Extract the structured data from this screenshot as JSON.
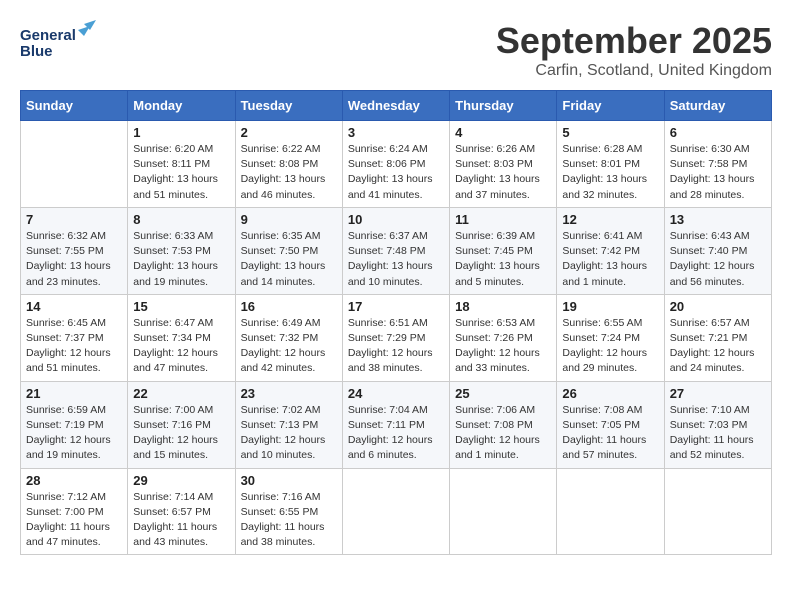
{
  "header": {
    "logo_line1": "General",
    "logo_line2": "Blue",
    "month_title": "September 2025",
    "location": "Carfin, Scotland, United Kingdom"
  },
  "days_of_week": [
    "Sunday",
    "Monday",
    "Tuesday",
    "Wednesday",
    "Thursday",
    "Friday",
    "Saturday"
  ],
  "weeks": [
    [
      {
        "day": "",
        "info": ""
      },
      {
        "day": "1",
        "info": "Sunrise: 6:20 AM\nSunset: 8:11 PM\nDaylight: 13 hours\nand 51 minutes."
      },
      {
        "day": "2",
        "info": "Sunrise: 6:22 AM\nSunset: 8:08 PM\nDaylight: 13 hours\nand 46 minutes."
      },
      {
        "day": "3",
        "info": "Sunrise: 6:24 AM\nSunset: 8:06 PM\nDaylight: 13 hours\nand 41 minutes."
      },
      {
        "day": "4",
        "info": "Sunrise: 6:26 AM\nSunset: 8:03 PM\nDaylight: 13 hours\nand 37 minutes."
      },
      {
        "day": "5",
        "info": "Sunrise: 6:28 AM\nSunset: 8:01 PM\nDaylight: 13 hours\nand 32 minutes."
      },
      {
        "day": "6",
        "info": "Sunrise: 6:30 AM\nSunset: 7:58 PM\nDaylight: 13 hours\nand 28 minutes."
      }
    ],
    [
      {
        "day": "7",
        "info": "Sunrise: 6:32 AM\nSunset: 7:55 PM\nDaylight: 13 hours\nand 23 minutes."
      },
      {
        "day": "8",
        "info": "Sunrise: 6:33 AM\nSunset: 7:53 PM\nDaylight: 13 hours\nand 19 minutes."
      },
      {
        "day": "9",
        "info": "Sunrise: 6:35 AM\nSunset: 7:50 PM\nDaylight: 13 hours\nand 14 minutes."
      },
      {
        "day": "10",
        "info": "Sunrise: 6:37 AM\nSunset: 7:48 PM\nDaylight: 13 hours\nand 10 minutes."
      },
      {
        "day": "11",
        "info": "Sunrise: 6:39 AM\nSunset: 7:45 PM\nDaylight: 13 hours\nand 5 minutes."
      },
      {
        "day": "12",
        "info": "Sunrise: 6:41 AM\nSunset: 7:42 PM\nDaylight: 13 hours\nand 1 minute."
      },
      {
        "day": "13",
        "info": "Sunrise: 6:43 AM\nSunset: 7:40 PM\nDaylight: 12 hours\nand 56 minutes."
      }
    ],
    [
      {
        "day": "14",
        "info": "Sunrise: 6:45 AM\nSunset: 7:37 PM\nDaylight: 12 hours\nand 51 minutes."
      },
      {
        "day": "15",
        "info": "Sunrise: 6:47 AM\nSunset: 7:34 PM\nDaylight: 12 hours\nand 47 minutes."
      },
      {
        "day": "16",
        "info": "Sunrise: 6:49 AM\nSunset: 7:32 PM\nDaylight: 12 hours\nand 42 minutes."
      },
      {
        "day": "17",
        "info": "Sunrise: 6:51 AM\nSunset: 7:29 PM\nDaylight: 12 hours\nand 38 minutes."
      },
      {
        "day": "18",
        "info": "Sunrise: 6:53 AM\nSunset: 7:26 PM\nDaylight: 12 hours\nand 33 minutes."
      },
      {
        "day": "19",
        "info": "Sunrise: 6:55 AM\nSunset: 7:24 PM\nDaylight: 12 hours\nand 29 minutes."
      },
      {
        "day": "20",
        "info": "Sunrise: 6:57 AM\nSunset: 7:21 PM\nDaylight: 12 hours\nand 24 minutes."
      }
    ],
    [
      {
        "day": "21",
        "info": "Sunrise: 6:59 AM\nSunset: 7:19 PM\nDaylight: 12 hours\nand 19 minutes."
      },
      {
        "day": "22",
        "info": "Sunrise: 7:00 AM\nSunset: 7:16 PM\nDaylight: 12 hours\nand 15 minutes."
      },
      {
        "day": "23",
        "info": "Sunrise: 7:02 AM\nSunset: 7:13 PM\nDaylight: 12 hours\nand 10 minutes."
      },
      {
        "day": "24",
        "info": "Sunrise: 7:04 AM\nSunset: 7:11 PM\nDaylight: 12 hours\nand 6 minutes."
      },
      {
        "day": "25",
        "info": "Sunrise: 7:06 AM\nSunset: 7:08 PM\nDaylight: 12 hours\nand 1 minute."
      },
      {
        "day": "26",
        "info": "Sunrise: 7:08 AM\nSunset: 7:05 PM\nDaylight: 11 hours\nand 57 minutes."
      },
      {
        "day": "27",
        "info": "Sunrise: 7:10 AM\nSunset: 7:03 PM\nDaylight: 11 hours\nand 52 minutes."
      }
    ],
    [
      {
        "day": "28",
        "info": "Sunrise: 7:12 AM\nSunset: 7:00 PM\nDaylight: 11 hours\nand 47 minutes."
      },
      {
        "day": "29",
        "info": "Sunrise: 7:14 AM\nSunset: 6:57 PM\nDaylight: 11 hours\nand 43 minutes."
      },
      {
        "day": "30",
        "info": "Sunrise: 7:16 AM\nSunset: 6:55 PM\nDaylight: 11 hours\nand 38 minutes."
      },
      {
        "day": "",
        "info": ""
      },
      {
        "day": "",
        "info": ""
      },
      {
        "day": "",
        "info": ""
      },
      {
        "day": "",
        "info": ""
      }
    ]
  ]
}
